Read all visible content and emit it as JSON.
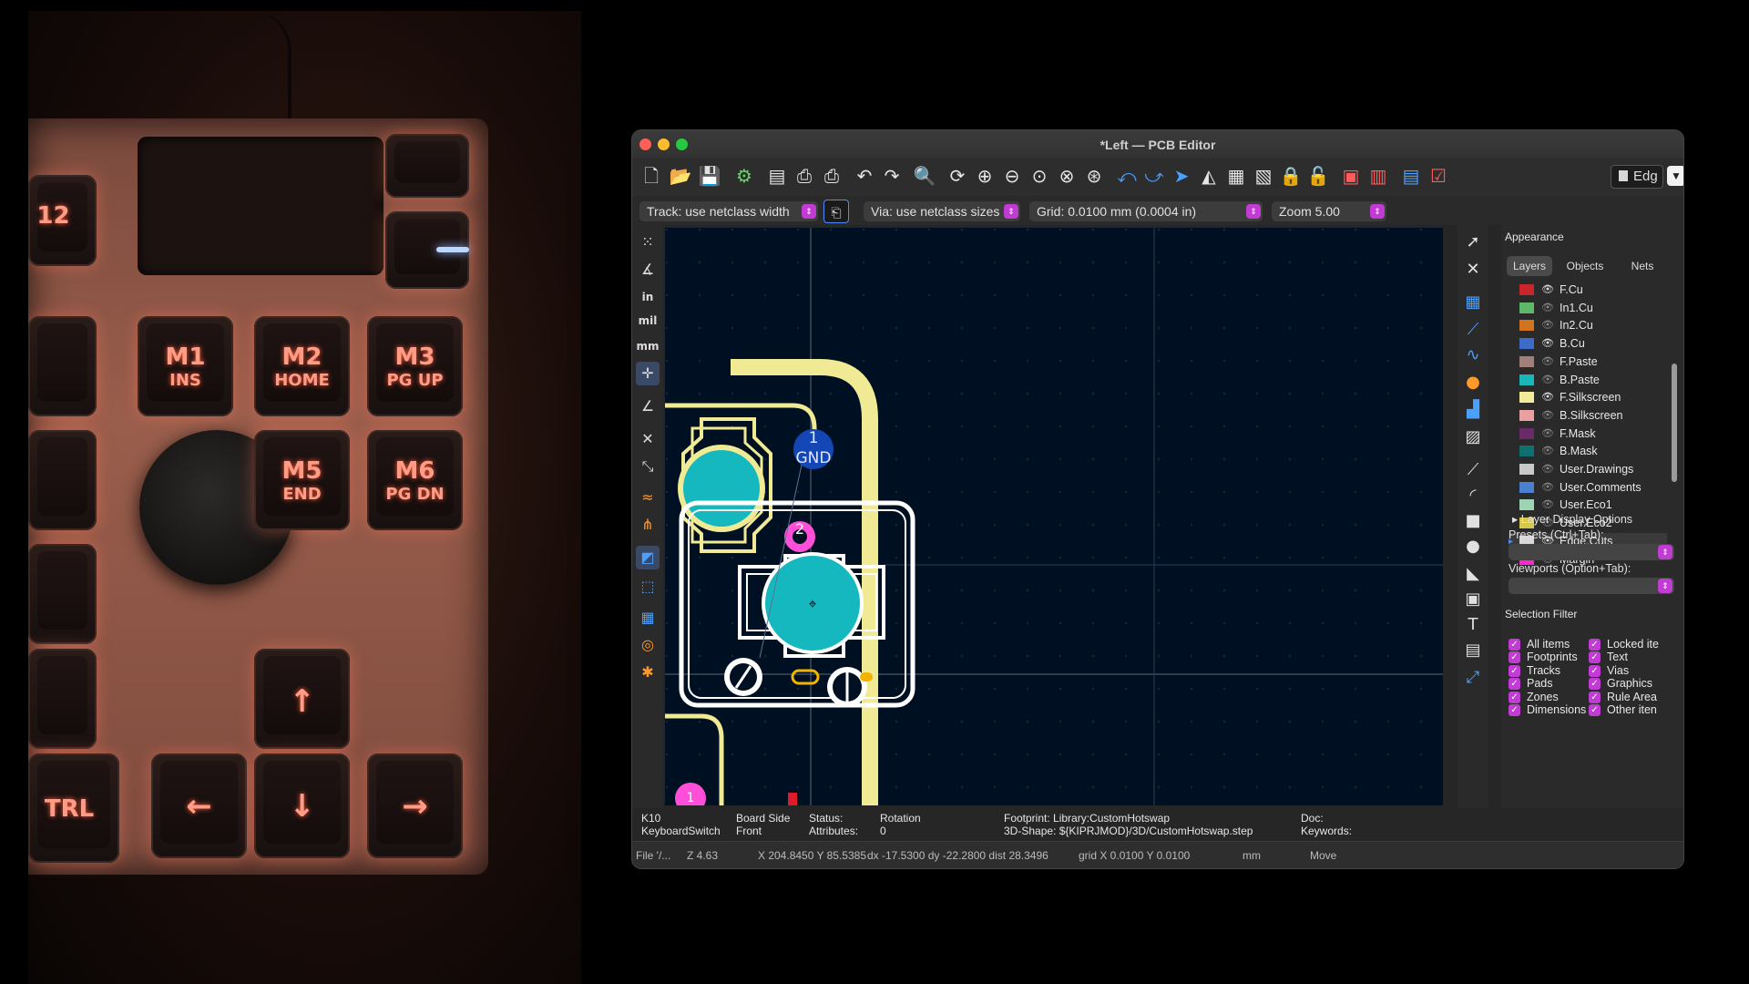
{
  "photo": {
    "keys": {
      "f12": "12",
      "m1": {
        "a": "M1",
        "b": "INS"
      },
      "m2": {
        "a": "M2",
        "b": "HOME"
      },
      "m3": {
        "a": "M3",
        "b": "PG UP"
      },
      "m5": {
        "a": "M5",
        "b": "END"
      },
      "m6": {
        "a": "M6",
        "b": "PG DN"
      },
      "ctrl": "TRL",
      "up": "↑",
      "left": "←",
      "down": "↓",
      "right": "→"
    }
  },
  "window": {
    "title": "*Left — PCB Editor",
    "toolbar": {
      "layer_selector": "Edg",
      "dropdown_icon": "chevron-down-icon"
    },
    "options": {
      "track": "Track: use netclass width",
      "via": "Via: use netclass sizes",
      "grid": "Grid: 0.0100 mm (0.0004 in)",
      "zoom": "Zoom 5.00"
    },
    "left_tools": {
      "inch": "in",
      "mil": "mil",
      "mm": "mm"
    },
    "canvas": {
      "pad1_number": "1",
      "pad1_net": "GND",
      "pad2_number": "2",
      "pad3_number": "1"
    },
    "appearance": {
      "title": "Appearance",
      "tabs": [
        "Layers",
        "Objects",
        "Nets"
      ],
      "layers": [
        {
          "name": "F.Cu",
          "color": "#c8262b",
          "visible": true
        },
        {
          "name": "In1.Cu",
          "color": "#5fb86a",
          "visible": false
        },
        {
          "name": "In2.Cu",
          "color": "#d0741f",
          "visible": false
        },
        {
          "name": "B.Cu",
          "color": "#3d6bc8",
          "visible": true
        },
        {
          "name": "F.Paste",
          "color": "#a08078",
          "visible": false
        },
        {
          "name": "B.Paste",
          "color": "#1ab6b8",
          "visible": false
        },
        {
          "name": "F.Silkscreen",
          "color": "#f2ec9a",
          "visible": true
        },
        {
          "name": "B.Silkscreen",
          "color": "#e8a0a0",
          "visible": false
        },
        {
          "name": "F.Mask",
          "color": "#6a2a6a",
          "visible": false
        },
        {
          "name": "B.Mask",
          "color": "#107070",
          "visible": false
        },
        {
          "name": "User.Drawings",
          "color": "#c8c8c8",
          "visible": false
        },
        {
          "name": "User.Comments",
          "color": "#4a80d0",
          "visible": false
        },
        {
          "name": "User.Eco1",
          "color": "#9ed4b4",
          "visible": false
        },
        {
          "name": "User.Eco2",
          "color": "#d8c84a",
          "visible": false
        },
        {
          "name": "Edge.Cuts",
          "color": "#d8d8d8",
          "visible": true
        },
        {
          "name": "Margin",
          "color": "#ff28d0",
          "visible": false
        }
      ],
      "layer_display_options": "Layer Display Options",
      "presets_label": "Presets (Ctrl+Tab):",
      "viewports_label": "Viewports (Option+Tab):"
    },
    "selection_filter": {
      "title": "Selection Filter",
      "left": [
        "All items",
        "Footprints",
        "Tracks",
        "Pads",
        "Zones",
        "Dimensions"
      ],
      "right": [
        "Locked ite",
        "Text",
        "Vias",
        "Graphics",
        "Rule Area",
        "Other iten"
      ]
    },
    "info": {
      "ref": "K10",
      "value": "KeyboardSwitch",
      "board_side_label": "Board Side",
      "board_side": "Front",
      "status_label": "Status:",
      "attributes_label": "Attributes:",
      "rotation_label": "Rotation",
      "rotation": "0",
      "footprint": "Footprint: Library:CustomHotswap",
      "shape3d": "3D-Shape: ${KIPRJMOD}/3D/CustomHotswap.step",
      "doc_label": "Doc:",
      "keywords_label": "Keywords:"
    },
    "status": {
      "file": "File '/...",
      "z": "Z 4.63",
      "xy": "X 204.8450  Y 85.5385",
      "delta": "dx -17.5300  dy -22.2800  dist 28.3496",
      "grid": "grid X 0.0100  Y 0.0100",
      "units": "mm",
      "mode": "Move"
    }
  }
}
